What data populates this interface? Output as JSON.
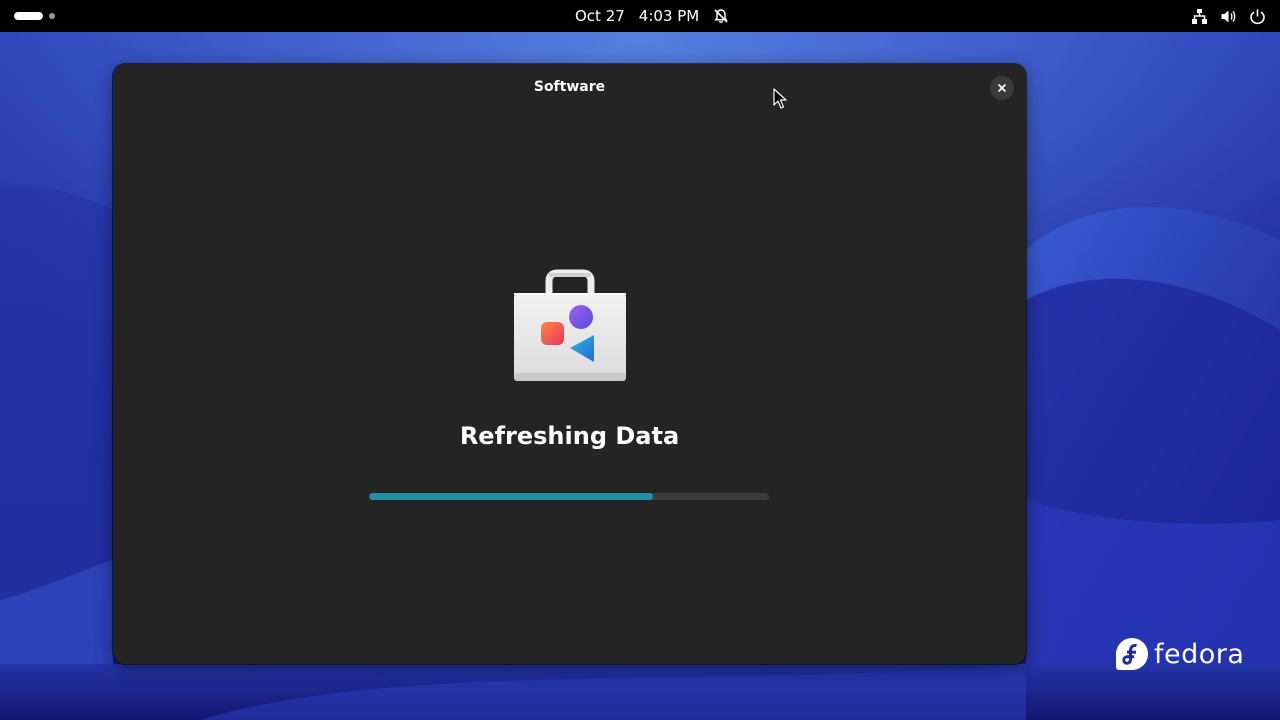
{
  "top_bar": {
    "date": "Oct 27",
    "time": "4:03 PM",
    "icons": [
      "activities-indicator",
      "notifications-disabled-icon",
      "network-icon",
      "volume-icon",
      "power-icon"
    ]
  },
  "window": {
    "title": "Software",
    "close_icon": "close-icon",
    "app_icon": "software-bag-icon",
    "status_title": "Refreshing Data",
    "progress": 0.71
  },
  "desktop": {
    "logo_text": "fedora"
  },
  "colors": {
    "accent": "#2190a4",
    "window_bg": "#242424",
    "top_bar_bg": "#000000"
  }
}
